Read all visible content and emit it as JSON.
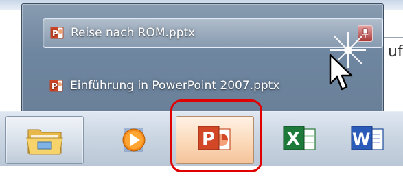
{
  "recent_files": [
    {
      "name": "Reise nach ROM.pptx",
      "icon": "pptx-file-icon"
    },
    {
      "name": "Einführung in PowerPoint 2007.pptx",
      "icon": "pptx-file-icon"
    }
  ],
  "background_text": "uf",
  "taskbar": {
    "buttons": [
      {
        "name": "windows-explorer",
        "icon": "folder-icon"
      },
      {
        "name": "media-player",
        "icon": "media-player-icon"
      },
      {
        "name": "powerpoint",
        "icon": "powerpoint-icon",
        "active": true
      },
      {
        "name": "excel",
        "icon": "excel-icon"
      },
      {
        "name": "word",
        "icon": "word-icon"
      }
    ]
  },
  "colors": {
    "highlight_frame": "#e00000",
    "jumplist_bg": "#7b90a7"
  }
}
